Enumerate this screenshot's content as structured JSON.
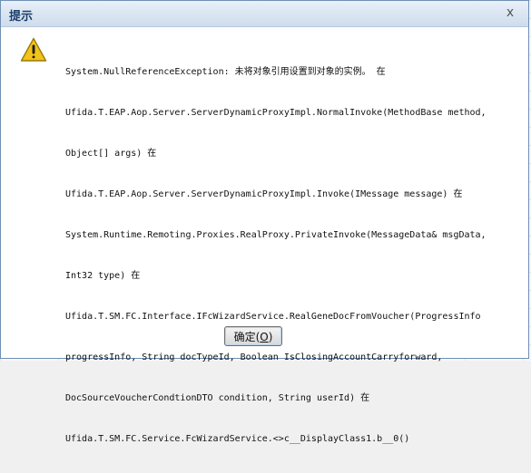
{
  "dialog": {
    "title": "提示",
    "close_glyph": "x",
    "icon": "warning-icon",
    "message_lines": [
      "System.NullReferenceException: 未将对象引用设置到对象的实例。 在",
      "Ufida.T.EAP.Aop.Server.ServerDynamicProxyImpl.NormalInvoke(MethodBase method,",
      "Object[] args) 在",
      "Ufida.T.EAP.Aop.Server.ServerDynamicProxyImpl.Invoke(IMessage message) 在",
      "System.Runtime.Remoting.Proxies.RealProxy.PrivateInvoke(MessageData& msgData,",
      "Int32 type) 在",
      "Ufida.T.SM.FC.Interface.IFcWizardService.RealGeneDocFromVoucher(ProgressInfo",
      "progressInfo, String docTypeId, Boolean IsClosingAccountCarryforward,",
      "DocSourceVoucherCondtionDTO condition, String userId) 在",
      "Ufida.T.SM.FC.Service.FcWizardService.<>c__DisplayClass1.b__0()"
    ],
    "ok_button": {
      "label": "确定(",
      "accel": "O",
      "suffix": ")"
    }
  },
  "colors": {
    "title_text": "#1b3d6b",
    "warning_fill": "#f2c318",
    "warning_border": "#9a7a10"
  }
}
